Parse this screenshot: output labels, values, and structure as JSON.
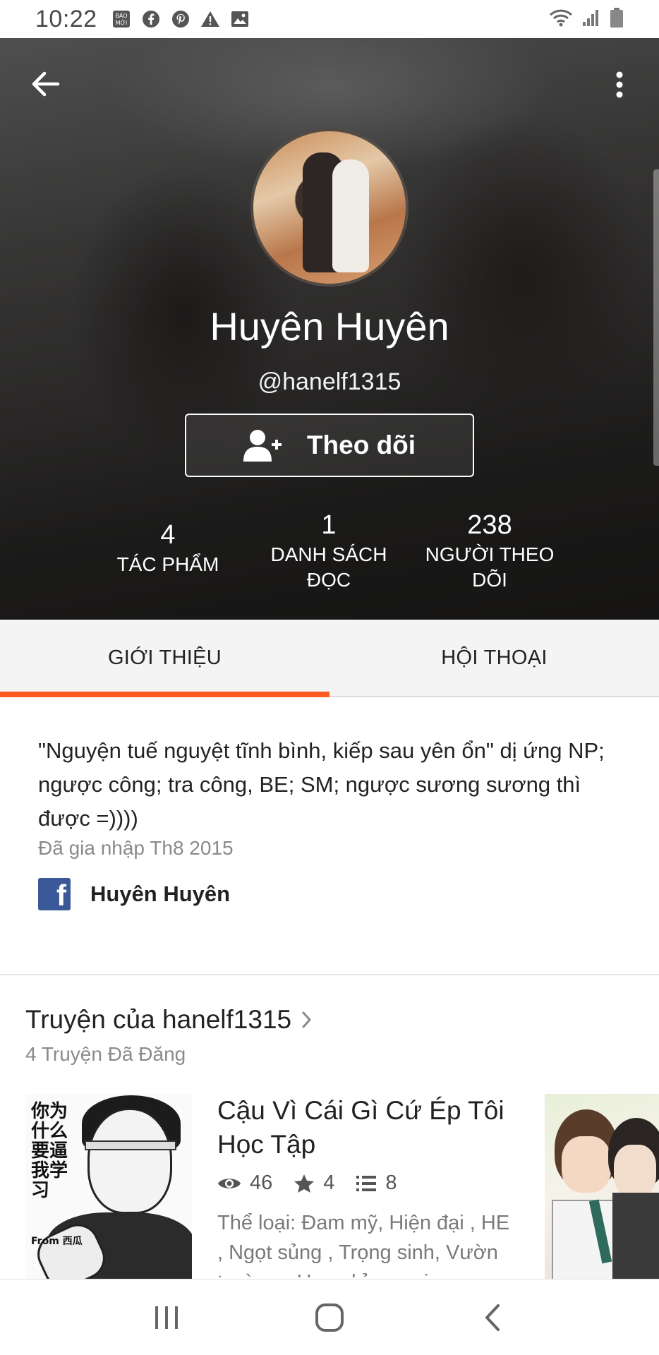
{
  "status_bar": {
    "time": "10:22",
    "left_icons": [
      "baomoi-icon",
      "facebook-icon",
      "pinterest-icon",
      "warning-icon",
      "image-icon"
    ],
    "right_icons": [
      "wifi-icon",
      "signal-icon",
      "battery-icon"
    ]
  },
  "profile": {
    "name": "Huyên Huyên",
    "handle": "@hanelf1315",
    "follow_label": "Theo dõi",
    "stats": [
      {
        "value": "4",
        "label": "TÁC PHẨM"
      },
      {
        "value": "1",
        "label": "DANH SÁCH ĐỌC"
      },
      {
        "value": "238",
        "label": "NGƯỜI THEO DÕI"
      }
    ]
  },
  "tabs": [
    {
      "label": "GIỚI THIỆU",
      "active": true
    },
    {
      "label": "HỘI THOẠI",
      "active": false
    }
  ],
  "about": {
    "bio": "\"Nguyện tuế nguyệt tĩnh bình, kiếp sau yên ổn\" dị ứng NP; ngược công; tra công, BE; SM; ngược sương sương thì được =))))",
    "joined": "Đã gia nhập Th8 2015",
    "facebook_name": "Huyên Huyên"
  },
  "stories": {
    "title": "Truyện của hanelf1315",
    "subtitle": "4 Truyện Đã Đăng",
    "items": [
      {
        "title": "Cậu Vì Cái Gì Cứ Ép Tôi Học Tập",
        "views": "46",
        "votes": "4",
        "parts": "8",
        "genres": "Thể loại: Đam mỹ, Hiện đại , HE , Ngọt sủng , Trọng sinh, Vườn trường , Hoan hỉ oan gi...",
        "cover_text": "你为什么要逼我学习",
        "cover_tag": "From 西瓜"
      }
    ]
  },
  "colors": {
    "accent": "#ff5a1f",
    "facebook": "#3b5998"
  }
}
